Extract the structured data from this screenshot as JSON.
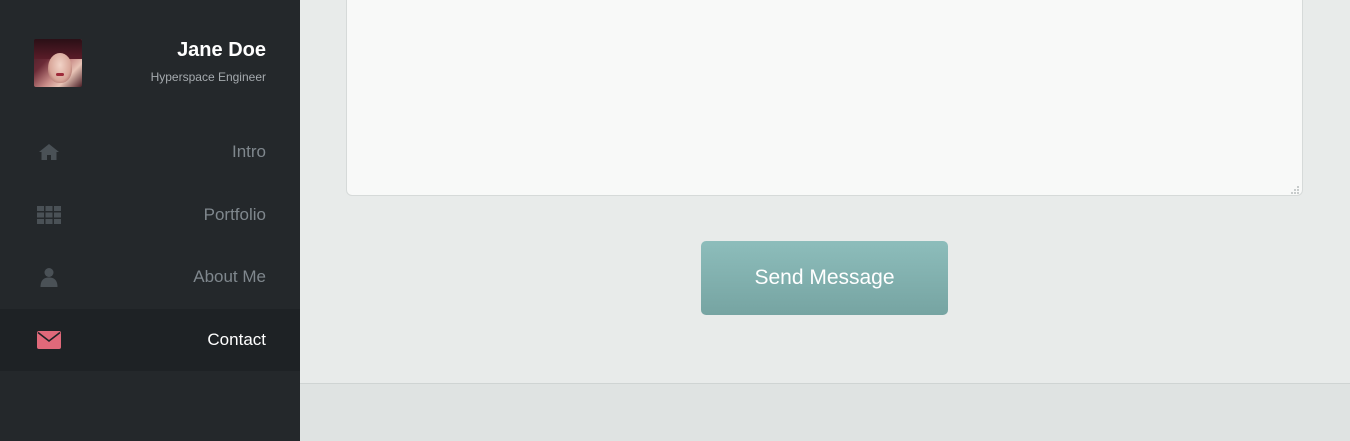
{
  "profile": {
    "name": "Jane Doe",
    "role": "Hyperspace Engineer",
    "avatar_icon": "avatar"
  },
  "nav": {
    "items": [
      {
        "label": "Intro",
        "icon": "home-icon",
        "active": false
      },
      {
        "label": "Portfolio",
        "icon": "grid-icon",
        "active": false
      },
      {
        "label": "About Me",
        "icon": "user-icon",
        "active": false
      },
      {
        "label": "Contact",
        "icon": "envelope-icon",
        "active": true
      }
    ]
  },
  "form": {
    "message_value": "",
    "send_label": "Send Message"
  },
  "colors": {
    "sidebar_bg": "#24282b",
    "active_item_bg": "#1e2225",
    "accent_contact_icon": "#e0697a",
    "button_bg": "#82b0ae",
    "content_bg": "#e8ebea"
  }
}
